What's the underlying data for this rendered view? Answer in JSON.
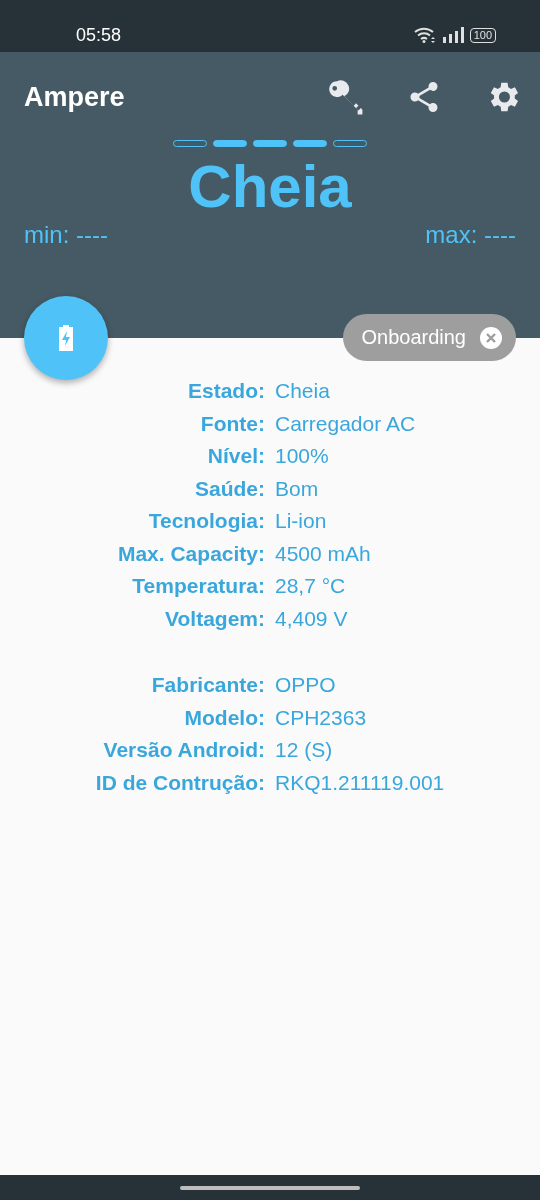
{
  "status_bar": {
    "time": "05:58",
    "battery": "100"
  },
  "app_bar": {
    "title": "Ampere"
  },
  "level_segments": [
    {
      "filled": false
    },
    {
      "filled": true
    },
    {
      "filled": true
    },
    {
      "filled": true
    },
    {
      "filled": false
    }
  ],
  "status": "Cheia",
  "min": "min: ----",
  "max": "max: ----",
  "chip": {
    "label": "Onboarding"
  },
  "groups": [
    [
      {
        "label": "Estado:",
        "value": "Cheia"
      },
      {
        "label": "Fonte:",
        "value": "Carregador AC"
      },
      {
        "label": "Nível:",
        "value": "100%"
      },
      {
        "label": "Saúde:",
        "value": "Bom"
      },
      {
        "label": "Tecnologia:",
        "value": "Li-ion"
      },
      {
        "label": "Max. Capacity:",
        "value": "4500 mAh"
      },
      {
        "label": "Temperatura:",
        "value": "28,7 °C"
      },
      {
        "label": "Voltagem:",
        "value": "4,409 V"
      }
    ],
    [
      {
        "label": "Fabricante:",
        "value": "OPPO"
      },
      {
        "label": "Modelo:",
        "value": "CPH2363"
      },
      {
        "label": "Versão Android:",
        "value": "12 (S)"
      },
      {
        "label": "ID de Contrução:",
        "value": "RKQ1.211119.001"
      }
    ]
  ]
}
